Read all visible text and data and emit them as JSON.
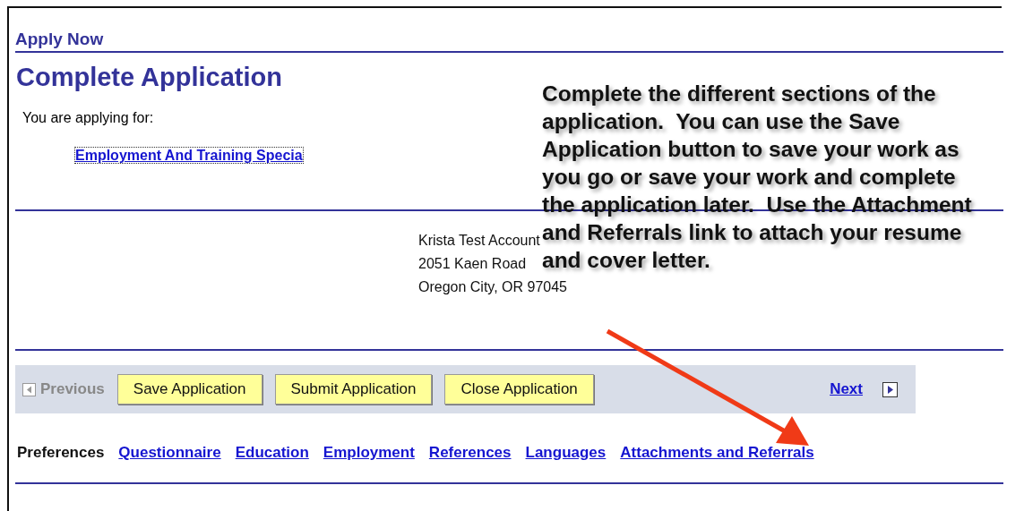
{
  "header": {
    "title": "Apply Now"
  },
  "page_title": "Complete Application",
  "applying_label": "You are applying for:",
  "job_link": "Employment And Training Specia",
  "address": [
    "Krista Test Account",
    "2051 Kaen Road",
    "Oregon City, OR 97045"
  ],
  "toolbar": {
    "previous": {
      "label": "Previous",
      "disabled": true
    },
    "buttons": [
      "Save Application",
      "Submit Application",
      "Close Application"
    ],
    "next": {
      "label": "Next",
      "disabled": false
    }
  },
  "sections": [
    {
      "label": "Preferences",
      "selected": true
    },
    {
      "label": "Questionnaire",
      "selected": false
    },
    {
      "label": "Education",
      "selected": false
    },
    {
      "label": "Employment",
      "selected": false
    },
    {
      "label": "References",
      "selected": false
    },
    {
      "label": "Languages",
      "selected": false
    },
    {
      "label": "Attachments and Referrals",
      "selected": false
    }
  ],
  "callout": "Complete the different sections of the application.  You can use the Save Application button to save your work as you go or save your work and complete the application later.  Use the Attachment and Referrals link to attach your resume and cover letter."
}
